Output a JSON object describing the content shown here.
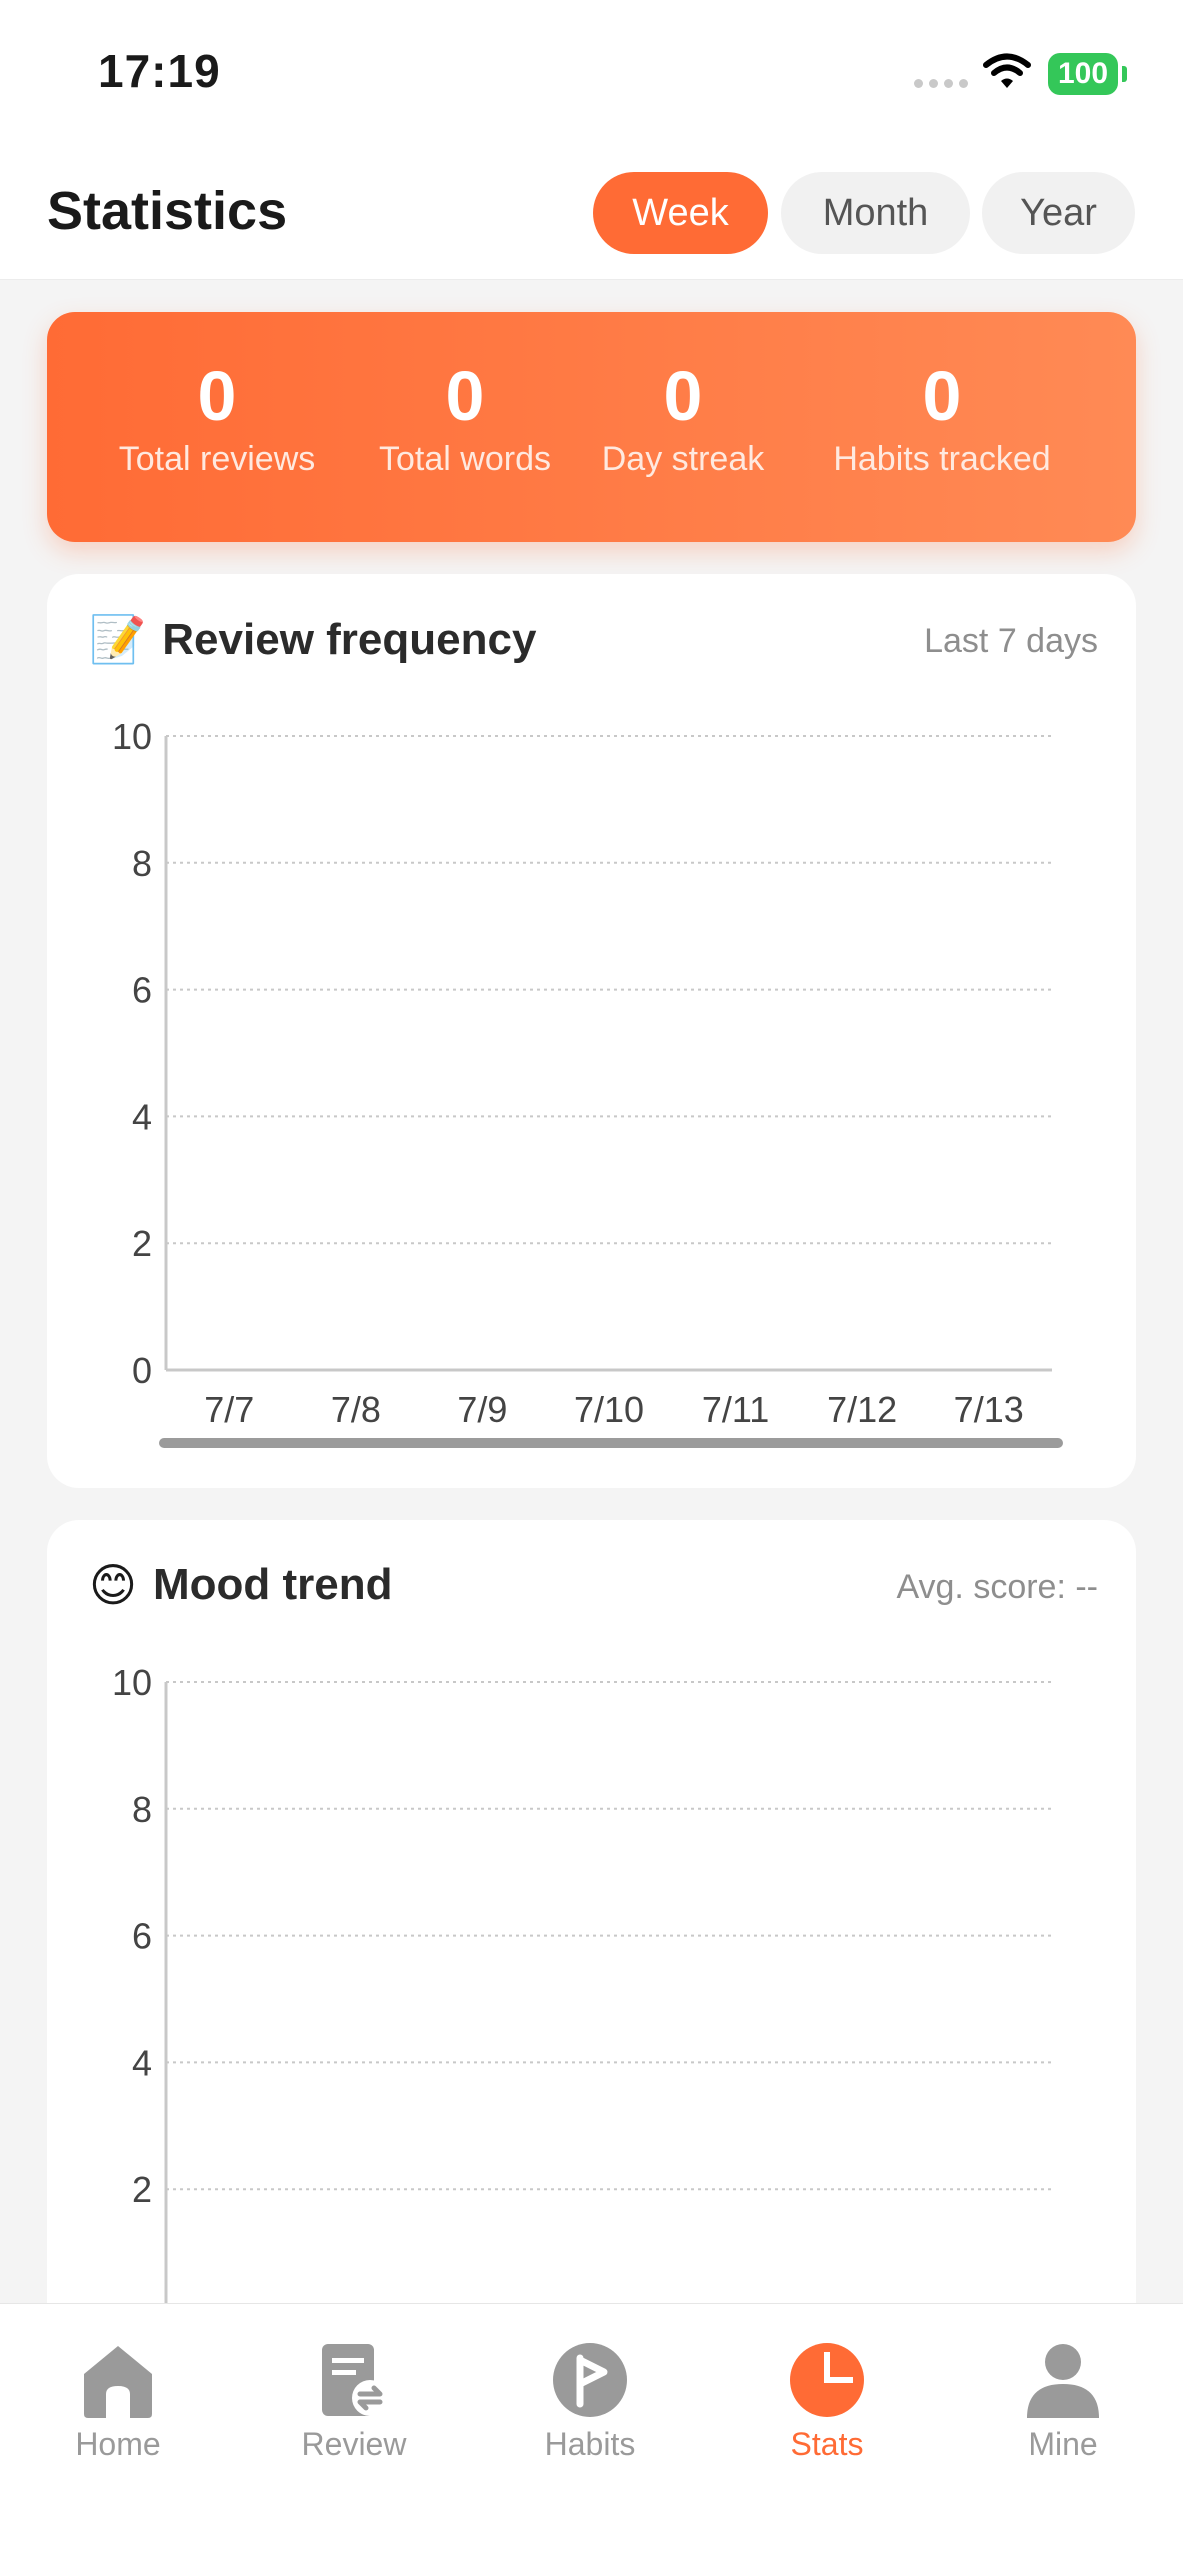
{
  "status_bar": {
    "time": "17:19",
    "battery": "100"
  },
  "header": {
    "title": "Statistics",
    "periods": [
      {
        "label": "Week",
        "active": true
      },
      {
        "label": "Month",
        "active": false
      },
      {
        "label": "Year",
        "active": false
      }
    ]
  },
  "summary": [
    {
      "value": "0",
      "label": "Total reviews"
    },
    {
      "value": "0",
      "label": "Total words"
    },
    {
      "value": "0",
      "label": "Day streak"
    },
    {
      "value": "0",
      "label": "Habits tracked"
    }
  ],
  "review_card": {
    "emoji": "📝",
    "title": "Review frequency",
    "meta": "Last 7 days"
  },
  "mood_card": {
    "emoji": "😊",
    "title": "Mood trend",
    "meta": "Avg. score: --"
  },
  "chart_data": [
    {
      "type": "bar",
      "title": "Review frequency",
      "categories": [
        "7/7",
        "7/8",
        "7/9",
        "7/10",
        "7/11",
        "7/12",
        "7/13"
      ],
      "values": [
        0,
        0,
        0,
        0,
        0,
        0,
        0
      ],
      "ylim": [
        0,
        10
      ],
      "yticks": [
        "0",
        "2",
        "4",
        "6",
        "8",
        "10"
      ],
      "grid": true
    },
    {
      "type": "line",
      "title": "Mood trend",
      "ylim": [
        0,
        10
      ],
      "yticks": [
        "2",
        "4",
        "6",
        "8",
        "10"
      ],
      "grid": true
    }
  ],
  "tab_bar": {
    "tabs": [
      {
        "label": "Home",
        "icon": "home-icon",
        "active": false
      },
      {
        "label": "Review",
        "icon": "review-icon",
        "active": false
      },
      {
        "label": "Habits",
        "icon": "habits-icon",
        "active": false
      },
      {
        "label": "Stats",
        "icon": "stats-icon",
        "active": true
      },
      {
        "label": "Mine",
        "icon": "mine-icon",
        "active": false
      }
    ],
    "accent": "#ff6b35",
    "inactive": "#9a9a9a"
  }
}
